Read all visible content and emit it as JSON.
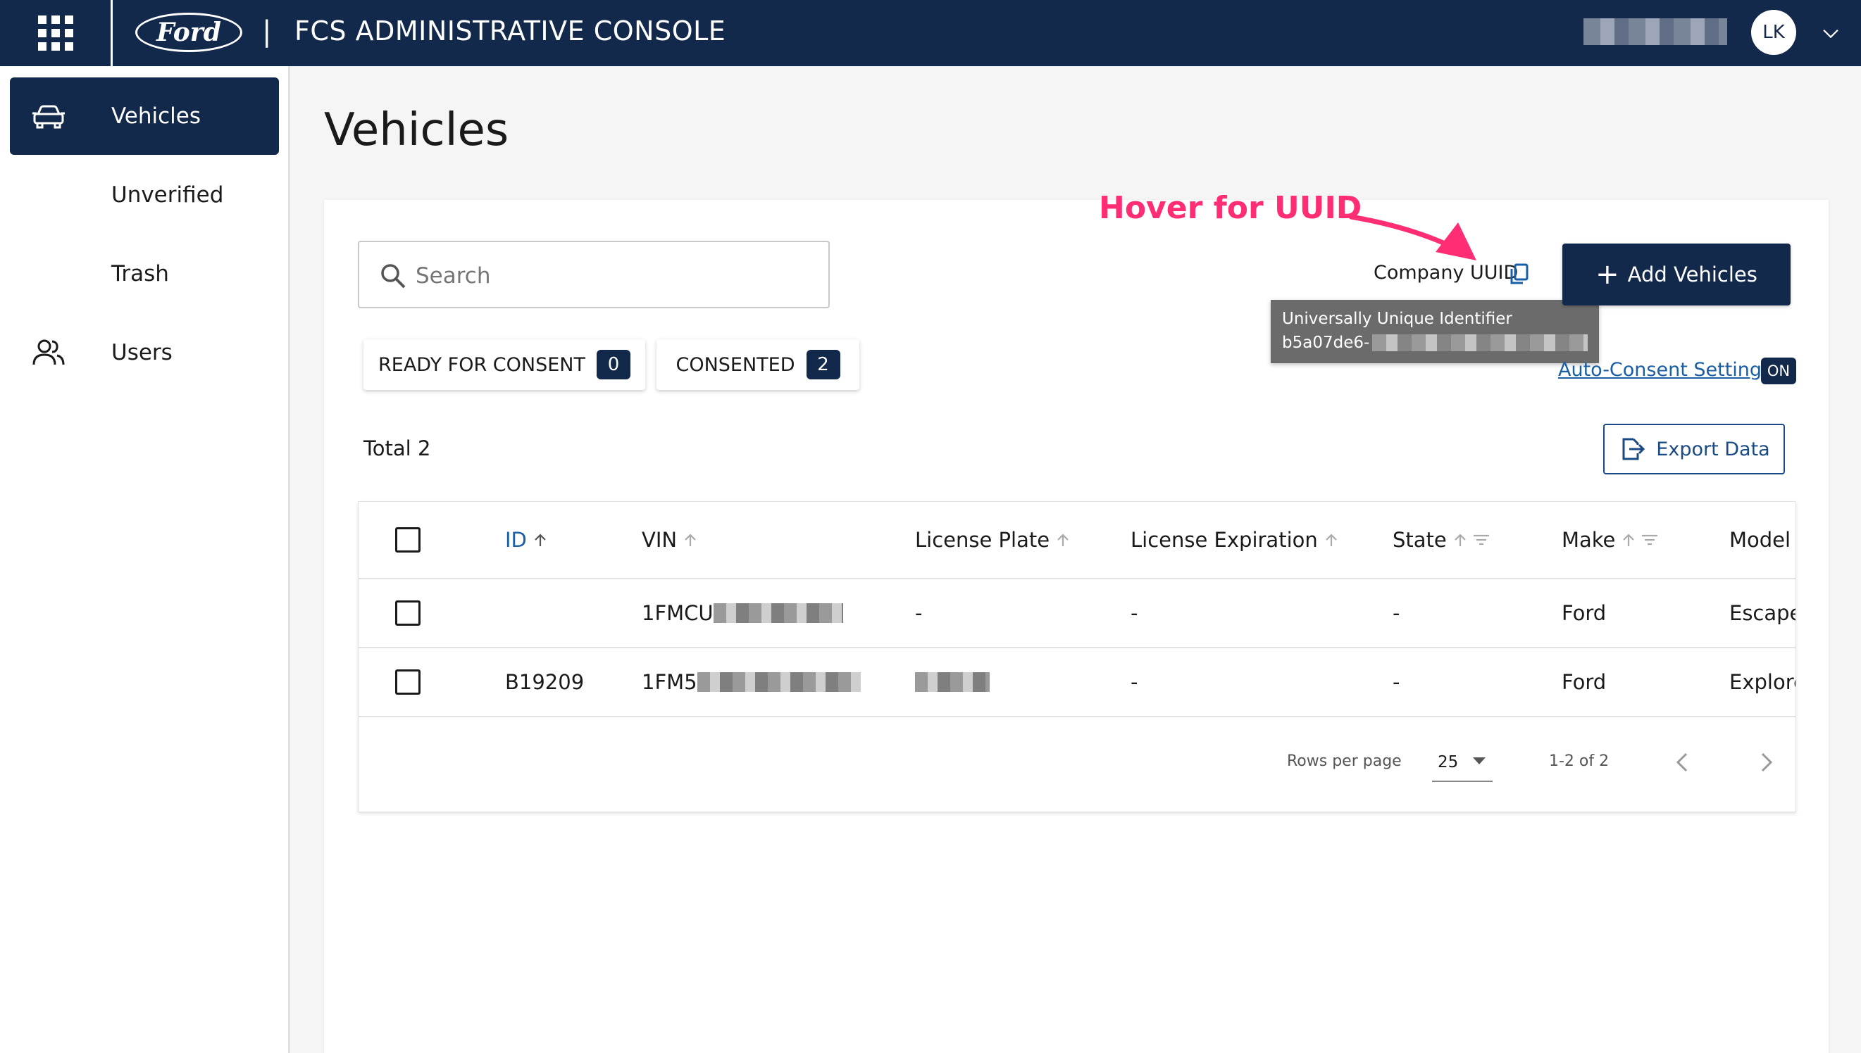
{
  "header": {
    "brand": "Ford",
    "separator": "|",
    "title": "FCS ADMINISTRATIVE CONSOLE",
    "avatar_initials": "LK"
  },
  "sidebar": {
    "items": [
      {
        "label": "Vehicles",
        "icon": "car-icon",
        "active": true
      },
      {
        "label": "Unverified"
      },
      {
        "label": "Trash"
      },
      {
        "label": "Users",
        "icon": "users-icon"
      }
    ]
  },
  "page": {
    "title": "Vehicles"
  },
  "toolbar": {
    "search_placeholder": "Search",
    "hover_hint": "Hover for UUID",
    "company_uuid_label": "Company UUID",
    "tooltip_title": "Universally Unique Identifier",
    "tooltip_uuid_prefix": "b5a07de6-",
    "add_button_label": "Add Vehicles",
    "auto_consent_link": "Auto-Consent Settings",
    "auto_consent_state": "ON"
  },
  "filters": [
    {
      "label": "READY FOR CONSENT",
      "count": "0"
    },
    {
      "label": "CONSENTED",
      "count": "2"
    }
  ],
  "summary": {
    "total": "Total 2",
    "export_label": "Export Data"
  },
  "table": {
    "columns": [
      "ID",
      "VIN",
      "License Plate",
      "License Expiration",
      "State",
      "Make",
      "Model"
    ],
    "rows": [
      {
        "id": "",
        "vin_prefix": "1FMCU",
        "license_plate": "-",
        "license_expiration": "-",
        "state": "-",
        "make": "Ford",
        "model": "Escape"
      },
      {
        "id": "B19209",
        "vin_prefix": "1FM5",
        "license_plate": "",
        "license_expiration": "-",
        "state": "-",
        "make": "Ford",
        "model": "Explore"
      }
    ]
  },
  "pagination": {
    "rows_per_page_label": "Rows per page",
    "rows_per_page_value": "25",
    "range": "1-2 of 2"
  },
  "colors": {
    "brand_navy": "#13294b",
    "link_blue": "#1a5ea6",
    "hint_pink": "#ff2e74"
  }
}
